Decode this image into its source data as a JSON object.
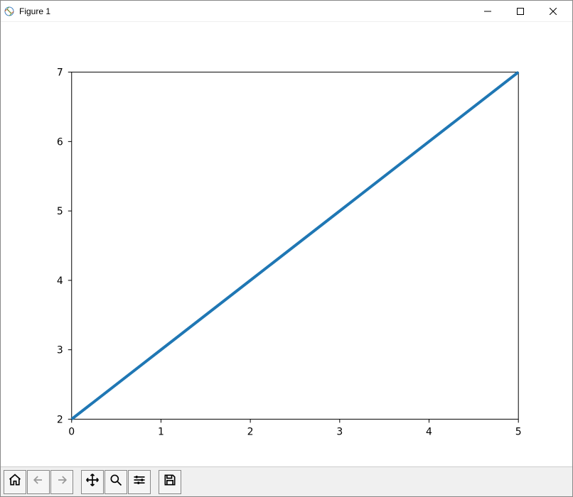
{
  "window": {
    "title": "Figure 1"
  },
  "chart_data": {
    "type": "line",
    "x": [
      0,
      1,
      2,
      3,
      4,
      5
    ],
    "y": [
      2,
      3,
      4,
      5,
      6,
      7
    ],
    "title": "",
    "xlabel": "",
    "ylabel": "",
    "xlim": [
      0,
      5
    ],
    "ylim": [
      2,
      7
    ],
    "xticks": [
      0,
      1,
      2,
      3,
      4,
      5
    ],
    "yticks": [
      2,
      3,
      4,
      5,
      6,
      7
    ],
    "line_color": "#1f77b4"
  },
  "toolbar": {
    "home": "Home",
    "back": "Back",
    "forward": "Forward",
    "pan": "Pan",
    "zoom": "Zoom",
    "configure": "Configure subplots",
    "save": "Save"
  }
}
